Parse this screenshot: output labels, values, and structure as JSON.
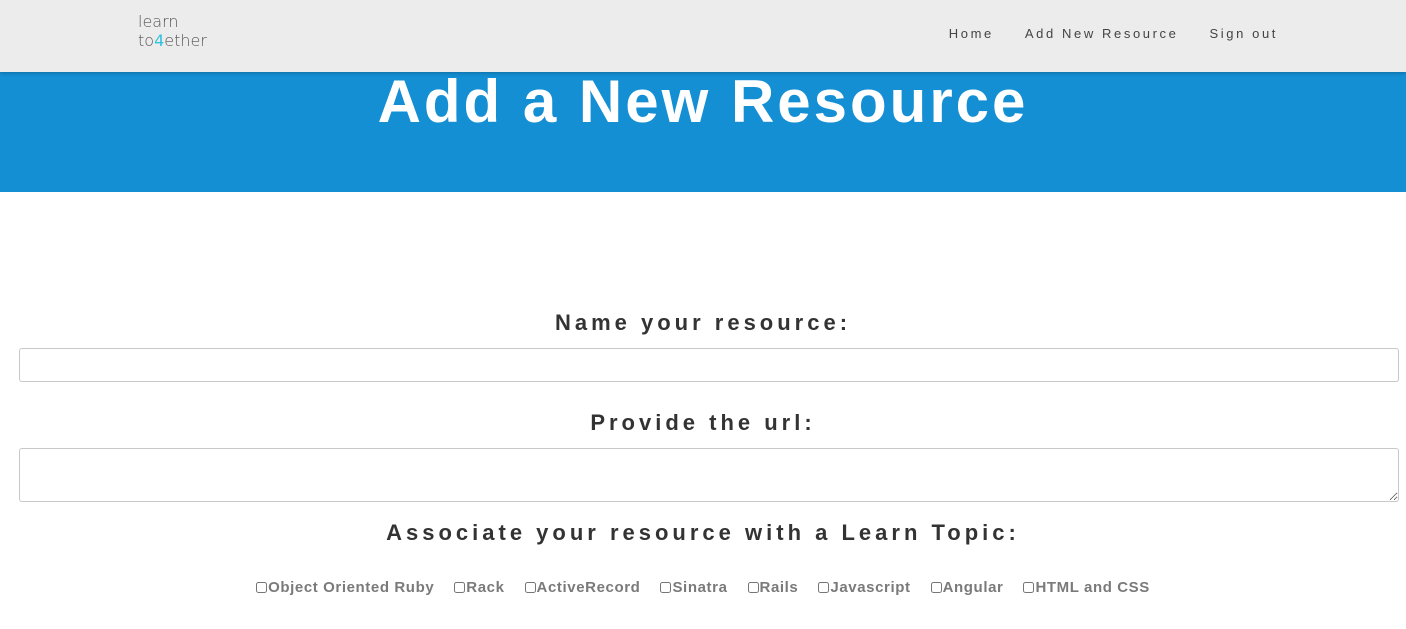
{
  "nav": {
    "logo_line1": "learn",
    "logo_line2_a": "to",
    "logo_line2_b": "4",
    "logo_line2_c": "ether",
    "links": [
      "Home",
      "Add New Resource",
      "Sign out"
    ]
  },
  "hero": {
    "title": "Add a New Resource",
    "background": "#148fd4"
  },
  "form": {
    "name_label": "Name your resource:",
    "name_value": "",
    "url_label": "Provide the url:",
    "url_value": "",
    "topic_label": "Associate your resource with a Learn Topic:",
    "topics": [
      {
        "label": "Object Oriented Ruby",
        "checked": false
      },
      {
        "label": "Rack",
        "checked": false
      },
      {
        "label": "ActiveRecord",
        "checked": false
      },
      {
        "label": "Sinatra",
        "checked": false
      },
      {
        "label": "Rails",
        "checked": false
      },
      {
        "label": "Javascript",
        "checked": false
      },
      {
        "label": "Angular",
        "checked": false
      },
      {
        "label": "HTML and CSS",
        "checked": false
      }
    ]
  },
  "colors": {
    "accent": "#148fd4",
    "logo_accent": "#2fc1e0",
    "navbar_bg": "#ececec"
  }
}
